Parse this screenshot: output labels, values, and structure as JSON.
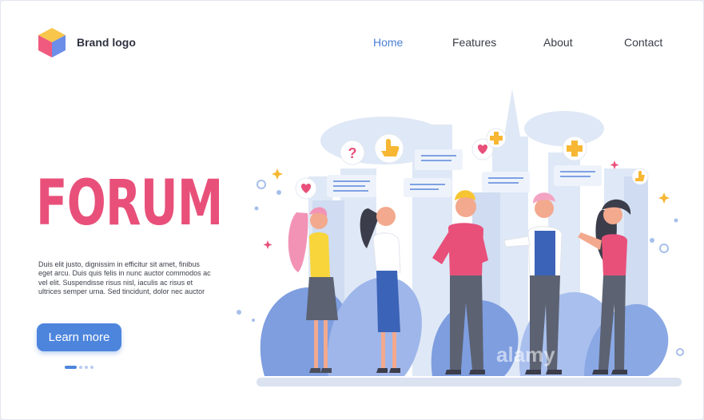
{
  "header": {
    "brand_name": "Brand logo",
    "nav": [
      {
        "label": "Home",
        "active": true
      },
      {
        "label": "Features",
        "active": false
      },
      {
        "label": "About",
        "active": false
      },
      {
        "label": "Contact",
        "active": false
      }
    ]
  },
  "hero": {
    "title": "FORUM",
    "body": "Duis elit justo, dignissim in efficitur sit amet, finibus eget arcu. Duis quis felis in nunc auctor commodos ac vel elit. Suspendisse risus nisl, iaculis ac risus et ultrices semper urna. Sed tincidunt, dolor nec auctor",
    "cta_label": "Learn more",
    "carousel": {
      "count": 4,
      "active": 1
    }
  },
  "watermark": "alamy",
  "colors": {
    "accent_pink": "#e8507a",
    "primary_blue": "#4d85dd",
    "nav_active": "#4a7fd4"
  }
}
